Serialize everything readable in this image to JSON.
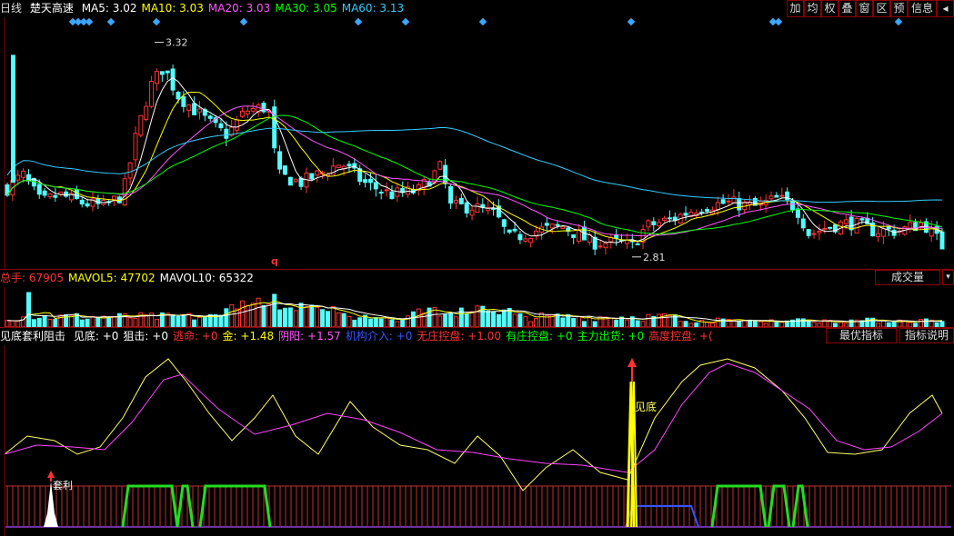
{
  "price_panel": {
    "period": "日线",
    "stock": "楚天高速",
    "ma": [
      {
        "label": "MA5:",
        "value": "3.02",
        "color": "#ffffff"
      },
      {
        "label": "MA10:",
        "value": "3.03",
        "color": "#ffff00"
      },
      {
        "label": "MA20:",
        "value": "3.03",
        "color": "#ff55ff"
      },
      {
        "label": "MA30:",
        "value": "3.05",
        "color": "#00ff00"
      },
      {
        "label": "MA60:",
        "value": "3.13",
        "color": "#33ccff"
      }
    ],
    "high_label": "3.32",
    "low_label": "2.81",
    "marker": "q"
  },
  "toolbar": [
    "加",
    "均",
    "权",
    "叠",
    "窗",
    "区",
    "预",
    "信息"
  ],
  "volume_panel": {
    "items": [
      {
        "label": "总手:",
        "value": "67905",
        "color": "#ff3333"
      },
      {
        "label": "MAVOL5:",
        "value": "47702",
        "color": "#ffff00"
      },
      {
        "label": "MAVOL10:",
        "value": "65322",
        "color": "#ffffff"
      }
    ],
    "button": "成交量"
  },
  "indicator_panel": {
    "title": "见底套利阻击",
    "items": [
      {
        "label": "见底:",
        "value": "+0",
        "color": "#ffffff"
      },
      {
        "label": "狙击:",
        "value": "+0",
        "color": "#ffffff"
      },
      {
        "label": "逃命:",
        "value": "+0",
        "color": "#ff3333"
      },
      {
        "label": "金:",
        "value": "+1.48",
        "color": "#ffff00"
      },
      {
        "label": "阴阳:",
        "value": "+1.57",
        "color": "#ff55ff"
      },
      {
        "label": "机构介入:",
        "value": "+0",
        "color": "#3355ff"
      },
      {
        "label": "无庄控盘:",
        "value": "+1.00",
        "color": "#ff3333"
      },
      {
        "label": "有庄控盘:",
        "value": "+0",
        "color": "#00ff00"
      },
      {
        "label": "主力出货:",
        "value": "+0",
        "color": "#00ff00"
      },
      {
        "label": "高度控盘:",
        "value": "+(",
        "color": "#ff3333"
      }
    ],
    "btn_best": "最优指标",
    "btn_explain": "指标说明",
    "signal_bottom": "见底",
    "signal_arb": "套利"
  },
  "colors": {
    "up": "#ff3333",
    "down": "#54fcfc",
    "frame": "#8a0000"
  }
}
